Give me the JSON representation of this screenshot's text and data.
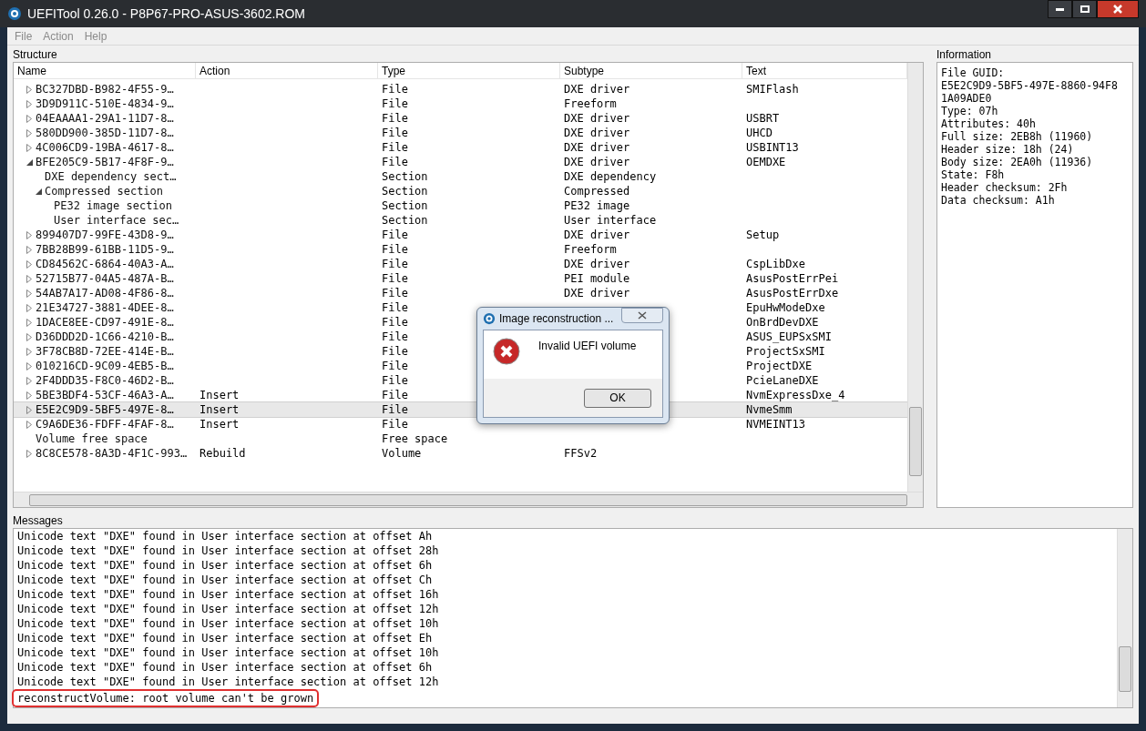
{
  "window": {
    "title": "UEFITool 0.26.0 - P8P67-PRO-ASUS-3602.ROM"
  },
  "menu": [
    "File",
    "Action",
    "Help"
  ],
  "structure": {
    "title": "Structure",
    "columns": [
      "Name",
      "Action",
      "Type",
      "Subtype",
      "Text"
    ],
    "tree": [
      {
        "children": [
          {
            "name": "BC327DBD-B982-4F55-9…",
            "type": "File",
            "subtype": "DXE driver",
            "text": "SMIFlash",
            "expanded": false,
            "selected": false
          },
          {
            "name": "3D9D911C-510E-4834-9…",
            "type": "File",
            "subtype": "Freeform",
            "expanded": false,
            "selected": false
          },
          {
            "name": "04EAAAA1-29A1-11D7-8…",
            "type": "File",
            "subtype": "DXE driver",
            "text": "USBRT",
            "expanded": false,
            "selected": false
          },
          {
            "name": "580DD900-385D-11D7-8…",
            "type": "File",
            "subtype": "DXE driver",
            "text": "UHCD",
            "expanded": false,
            "selected": false
          },
          {
            "name": "4C006CD9-19BA-4617-8…",
            "type": "File",
            "subtype": "DXE driver",
            "text": "USBINT13",
            "expanded": false,
            "selected": false
          },
          {
            "name": "BFE205C9-5B17-4F8F-9…",
            "type": "File",
            "subtype": "DXE driver",
            "text": "OEMDXE",
            "expanded": true,
            "selected": false,
            "children": [
              {
                "name": "DXE dependency sect…",
                "type": "Section",
                "subtype": "DXE dependency",
                "selected": false
              },
              {
                "name": "Compressed section",
                "type": "Section",
                "subtype": "Compressed",
                "expanded": true,
                "selected": false,
                "children": [
                  {
                    "name": "PE32 image section",
                    "type": "Section",
                    "subtype": "PE32 image",
                    "selected": false
                  },
                  {
                    "name": "User interface sec…",
                    "type": "Section",
                    "subtype": "User interface",
                    "selected": false
                  }
                ]
              }
            ]
          },
          {
            "name": "899407D7-99FE-43D8-9…",
            "type": "File",
            "subtype": "DXE driver",
            "text": "Setup",
            "expanded": false,
            "selected": false
          },
          {
            "name": "7BB28B99-61BB-11D5-9…",
            "type": "File",
            "subtype": "Freeform",
            "expanded": false,
            "selected": false
          },
          {
            "name": "CD84562C-6864-40A3-A…",
            "type": "File",
            "subtype": "DXE driver",
            "text": "CspLibDxe",
            "expanded": false,
            "selected": false
          },
          {
            "name": "52715B77-04A5-487A-B…",
            "type": "File",
            "subtype": "PEI module",
            "text": "AsusPostErrPei",
            "expanded": false,
            "selected": false
          },
          {
            "name": "54AB7A17-AD08-4F86-8…",
            "type": "File",
            "subtype": "DXE driver",
            "text": "AsusPostErrDxe",
            "expanded": false,
            "selected": false
          },
          {
            "name": "21E34727-3881-4DEE-8…",
            "type": "File",
            "text": "EpuHwModeDxe",
            "expanded": false,
            "selected": false
          },
          {
            "name": "1DACE8EE-CD97-491E-8…",
            "type": "File",
            "text": "OnBrdDevDXE",
            "expanded": false,
            "selected": false
          },
          {
            "name": "D36DDD2D-1C66-4210-B…",
            "type": "File",
            "text": "ASUS_EUPSxSMI",
            "expanded": false,
            "selected": false
          },
          {
            "name": "3F78CB8D-72EE-414E-B…",
            "type": "File",
            "text": "ProjectSxSMI",
            "expanded": false,
            "selected": false
          },
          {
            "name": "010216CD-9C09-4EB5-B…",
            "type": "File",
            "text": "ProjectDXE",
            "expanded": false,
            "selected": false
          },
          {
            "name": "2F4DDD35-F8C0-46D2-B…",
            "type": "File",
            "text": "PcieLaneDXE",
            "expanded": false,
            "selected": false
          },
          {
            "name": "5BE3BDF4-53CF-46A3-A…",
            "action": "Insert",
            "type": "File",
            "text": "NvmExpressDxe_4",
            "expanded": false,
            "selected": false
          },
          {
            "name": "E5E2C9D9-5BF5-497E-8…",
            "action": "Insert",
            "type": "File",
            "text": "NvmeSmm",
            "expanded": false,
            "selected": true
          },
          {
            "name": "C9A6DE36-FDFF-4FAF-8…",
            "action": "Insert",
            "type": "File",
            "text": "NVMEINT13",
            "expanded": false,
            "selected": false
          },
          {
            "name": "Volume free space",
            "type": "Free space",
            "selected": false
          }
        ]
      },
      {
        "name": "8C8CE578-8A3D-4F1C-993…",
        "action": "Rebuild",
        "type": "Volume",
        "subtype": "FFSv2",
        "expanded": false,
        "selected": false
      }
    ]
  },
  "information": {
    "title": "Information",
    "lines": [
      "File GUID:",
      "E5E2C9D9-5BF5-497E-8860-94F8",
      "1A09ADE0",
      "Type: 07h",
      "Attributes: 40h",
      "Full size: 2EB8h (11960)",
      "Header size: 18h (24)",
      "Body size: 2EA0h (11936)",
      "State: F8h",
      "Header checksum: 2Fh",
      "Data checksum: A1h"
    ]
  },
  "messages": {
    "title": "Messages",
    "lines": [
      {
        "text": "Unicode text \"DXE\" found in User interface section at offset Ah",
        "highlighted": false
      },
      {
        "text": "Unicode text \"DXE\" found in User interface section at offset 28h",
        "highlighted": false
      },
      {
        "text": "Unicode text \"DXE\" found in User interface section at offset 6h",
        "highlighted": false
      },
      {
        "text": "Unicode text \"DXE\" found in User interface section at offset Ch",
        "highlighted": false
      },
      {
        "text": "Unicode text \"DXE\" found in User interface section at offset 16h",
        "highlighted": false
      },
      {
        "text": "Unicode text \"DXE\" found in User interface section at offset 12h",
        "highlighted": false
      },
      {
        "text": "Unicode text \"DXE\" found in User interface section at offset 10h",
        "highlighted": false
      },
      {
        "text": "Unicode text \"DXE\" found in User interface section at offset Eh",
        "highlighted": false
      },
      {
        "text": "Unicode text \"DXE\" found in User interface section at offset 10h",
        "highlighted": false
      },
      {
        "text": "Unicode text \"DXE\" found in User interface section at offset 6h",
        "highlighted": false
      },
      {
        "text": "Unicode text \"DXE\" found in User interface section at offset 12h",
        "highlighted": false
      },
      {
        "text": "reconstructVolume: root volume can't be grown",
        "highlighted": true
      }
    ]
  },
  "dialog": {
    "title": "Image reconstruction ...",
    "message": "Invalid UEFI volume",
    "button": "OK"
  }
}
